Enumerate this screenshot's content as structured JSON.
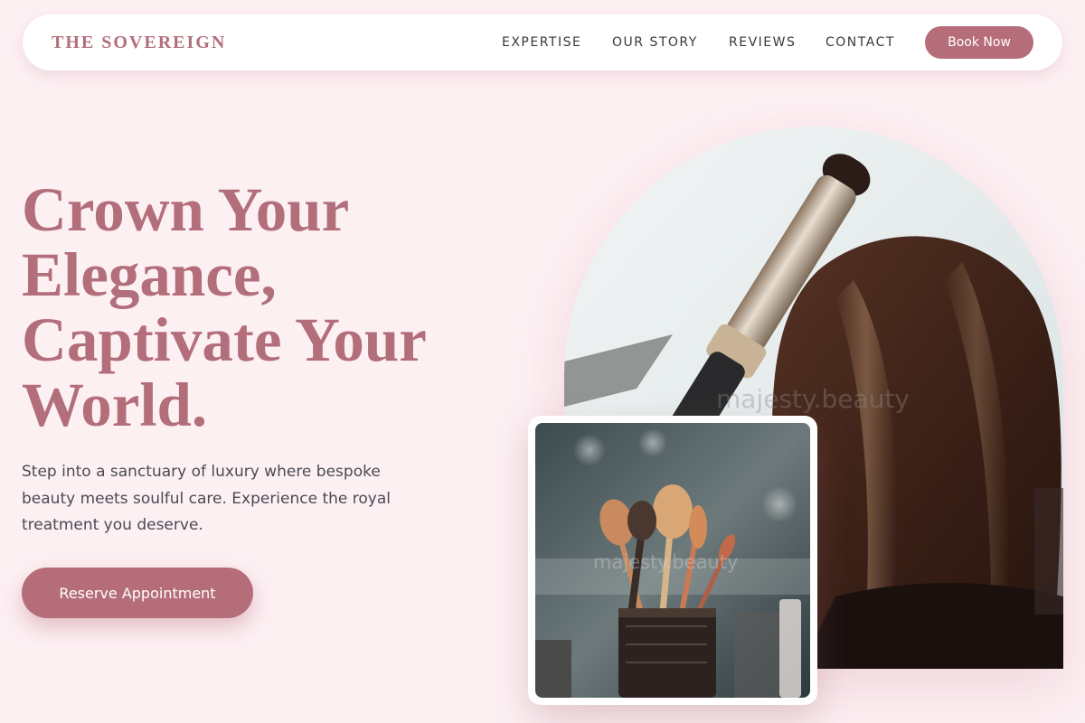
{
  "nav": {
    "brand": "THE SOVEREIGN",
    "links": [
      "EXPERTISE",
      "OUR STORY",
      "REVIEWS",
      "CONTACT"
    ],
    "book_label": "Book Now"
  },
  "hero": {
    "title": "Crown Your Elegance, Captivate Your World.",
    "subtitle": "Step into a sanctuary of luxury where bespoke beauty meets soulful care. Experience the royal treatment you deserve.",
    "cta_label": "Reserve Appointment"
  },
  "images": {
    "watermark": "majesty.beauty"
  },
  "colors": {
    "background": "#fdf0f3",
    "accent": "#b56d79",
    "heading": "#b36e7b",
    "body_text": "#4a4a54",
    "nav_text": "#3a3a3a"
  }
}
